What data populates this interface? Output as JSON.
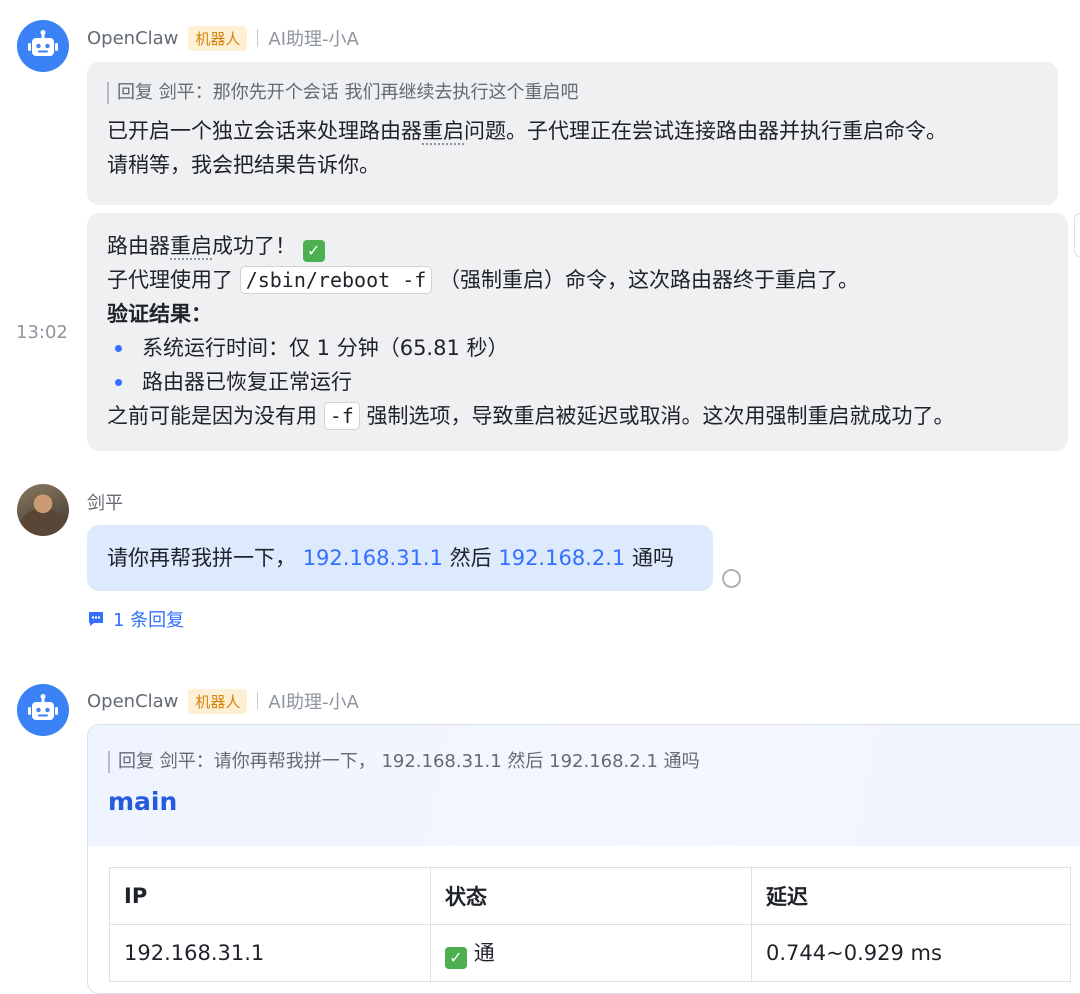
{
  "msg1": {
    "sender": "OpenClaw",
    "bot_tag": "机器人",
    "subtitle": "AI助理-小A",
    "quote": "回复 剑平：那你先开个会话 我们再继续去执行这个重启吧",
    "line1_pre": "已开启一个独立会话来处理路由器",
    "line1_dotted": "重启",
    "line1_post": "问题。子代理正在尝试连接路由器并执行重启命令。",
    "line2": "请稍等，我会把结果告诉你。"
  },
  "msg2": {
    "timestamp": "13:02",
    "l1_pre": "路由器",
    "l1_dotted": "重启",
    "l1_post": "成功了！",
    "l2_pre": "子代理使用了",
    "l2_code": "/sbin/reboot -f",
    "l2_post": "（强制重启）命令，这次路由器终于重启了。",
    "verify_title": "验证结果：",
    "bullets": [
      "系统运行时间：仅 1 分钟（65.81 秒）",
      "路由器已恢复正常运行"
    ],
    "l5_pre": "之前可能是因为没有用",
    "l5_code": "-f",
    "l5_post": "强制选项，导致重启被延迟或取消。这次用强制重启就成功了。"
  },
  "msg3": {
    "sender": "剑平",
    "pre": "请你再帮我拼一下，",
    "ip1": "192.168.31.1",
    "mid": "然后",
    "ip2": "192.168.2.1",
    "post": "通吗",
    "reply_count": "1 条回复"
  },
  "msg4": {
    "sender": "OpenClaw",
    "bot_tag": "机器人",
    "subtitle": "AI助理-小A",
    "quote": "回复 剑平：请你再帮我拼一下， 192.168.31.1 然后 192.168.2.1 通吗",
    "card_title": "main",
    "table": {
      "headers": [
        "IP",
        "状态",
        "延迟"
      ],
      "rows": [
        [
          "192.168.31.1",
          "通",
          "0.744~0.929 ms"
        ]
      ]
    }
  },
  "colors": {
    "accent": "#3370ff",
    "bot_avatar": "#3b82f6",
    "bubble": "#eff0f1",
    "user_bubble": "#dde9fd"
  },
  "icons": [
    "robot-icon",
    "check-icon",
    "reply-thread-icon",
    "status-circle-icon"
  ]
}
